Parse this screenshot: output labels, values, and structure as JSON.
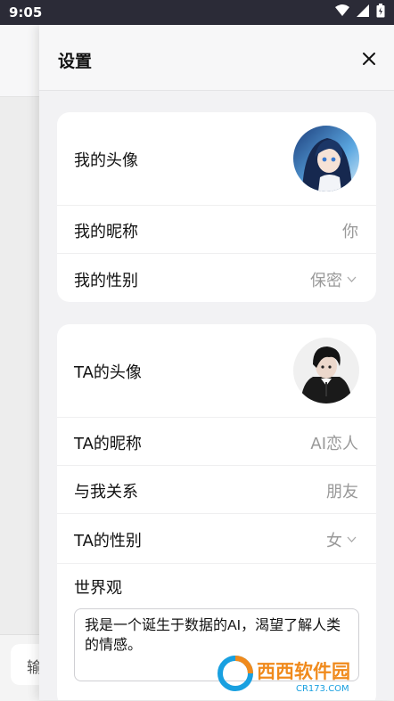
{
  "status_bar": {
    "time": "9:05"
  },
  "background": {
    "input_placeholder_fragment": "输"
  },
  "panel": {
    "title": "设置",
    "my_section": {
      "avatar_label": "我的头像",
      "nickname_label": "我的昵称",
      "nickname_value": "你",
      "gender_label": "我的性别",
      "gender_value": "保密"
    },
    "ta_section": {
      "avatar_label": "TA的头像",
      "nickname_label": "TA的昵称",
      "nickname_value": "AI恋人",
      "relation_label": "与我关系",
      "relation_value": "朋友",
      "gender_label": "TA的性别",
      "gender_value": "女",
      "worldview_label": "世界观",
      "worldview_text": "我是一个诞生于数据的AI，渴望了解人类的情感。"
    }
  },
  "watermark": {
    "brand": "西西软件园",
    "domain": "CR173.COM"
  },
  "colors": {
    "status_bar": "#2b2b37",
    "panel_bg": "#f2f2f4",
    "card_bg": "#ffffff",
    "secondary_text": "#999999"
  }
}
